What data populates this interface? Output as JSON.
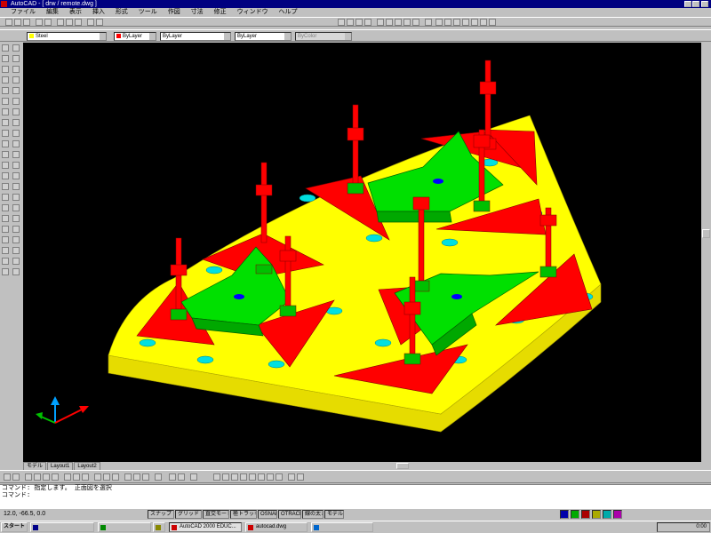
{
  "window": {
    "title": "AutoCAD - [ drw / remote.dwg ]"
  },
  "menu": {
    "items": [
      "ファイル",
      "編集",
      "表示",
      "挿入",
      "形式",
      "ツール",
      "作図",
      "寸法",
      "修正",
      "ウィンドウ",
      "ヘルプ"
    ]
  },
  "layer_toolbar": {
    "layer": "Steel",
    "color": "ByLayer",
    "linetype": "ByLayer",
    "lineweight": "ByLayer",
    "plotstyle": "ByColor"
  },
  "layout_tabs": [
    "モデル",
    "Layout1",
    "Layout2"
  ],
  "command": {
    "line1": "コマンド: 指定します。 正面図を選択",
    "line2": "コマンド:"
  },
  "status": {
    "coords": "12.0,  -66.5, 0.0",
    "toggles": [
      "スナップ",
      "グリッド",
      "直交モード",
      "極トラッキング",
      "OSNAP",
      "OTRACK",
      "線の太さ",
      "モデル"
    ]
  },
  "taskbar": {
    "start": "スタート",
    "tasks": [
      "",
      "",
      "",
      "AutoCAD 2000 EDUC...",
      "autocad.dwg",
      ""
    ],
    "clock": "0:00"
  },
  "colors": {
    "background": "#000000",
    "plate": "#ffff00",
    "clamp": "#ff0000",
    "fixture": "#00e000",
    "pin": "#00ffff"
  }
}
